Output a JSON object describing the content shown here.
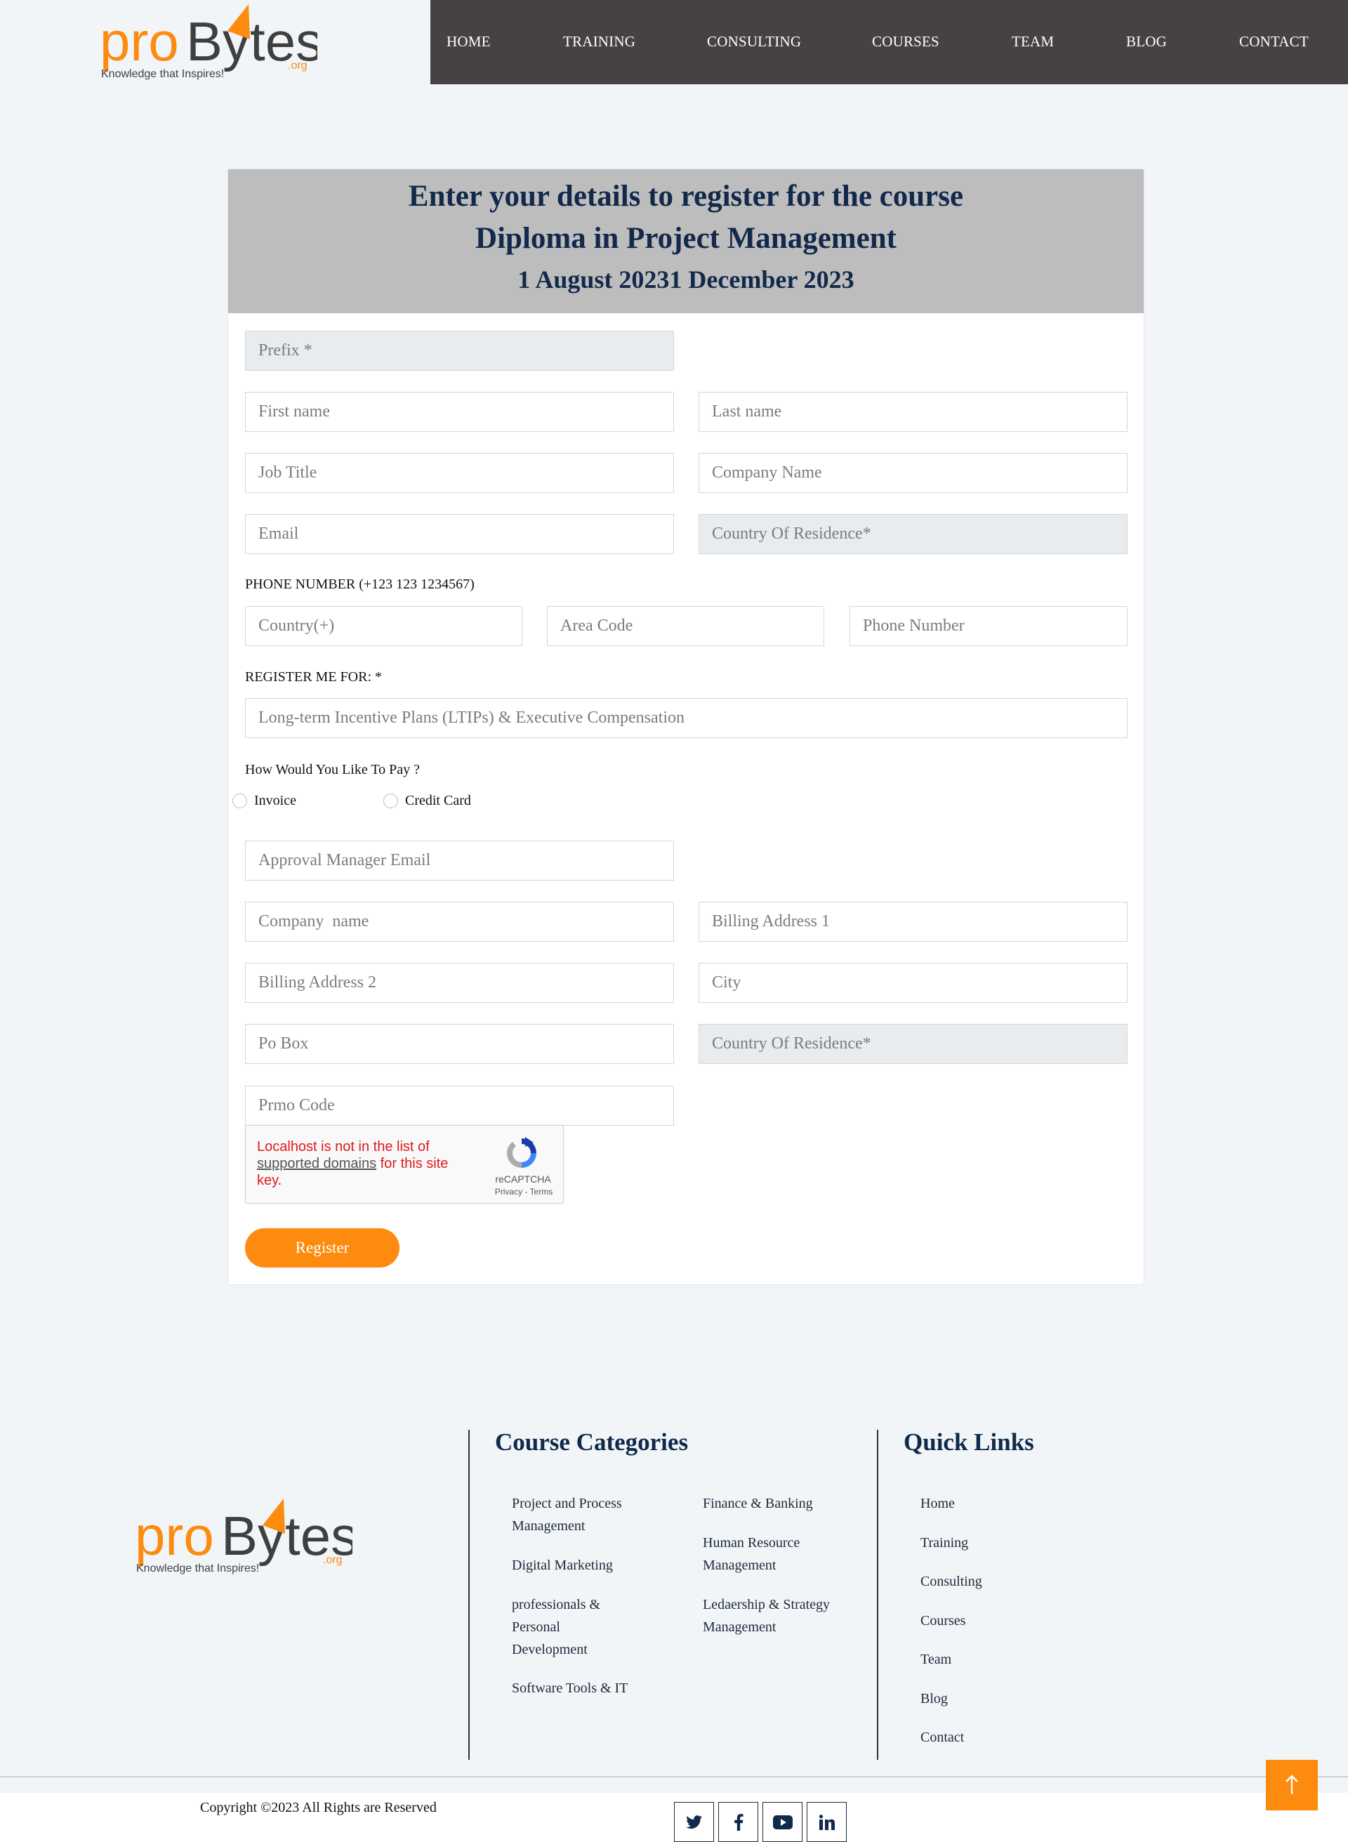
{
  "brand": {
    "logo_text_pro": "pro",
    "logo_text_bytes": "Bytes",
    "logo_domain": ".org",
    "tagline": "Knowledge that Inspires!",
    "orange": "#fc8b0f",
    "dark": "#3f3f3f"
  },
  "nav": {
    "items": [
      "HOME",
      "TRAINING",
      "CONSULTING",
      "COURSES",
      "TEAM",
      "BLOG",
      "CONTACT"
    ],
    "background": "#454241"
  },
  "form": {
    "heading_line1": "Enter your details to register for the course",
    "heading_line2": "Diploma in Project Management",
    "heading_line3": "1 August 20231 December 2023",
    "prefix_placeholder": "Prefix *",
    "first_name_placeholder": "First name",
    "last_name_placeholder": "Last name",
    "job_title_placeholder": "Job Title",
    "company_name_placeholder": "Company Name",
    "email_placeholder": "Email",
    "country_residence_placeholder": "Country Of Residence*",
    "phone_label": "PHONE NUMBER (+123 123 1234567)",
    "phone_country_placeholder": "Country(+)",
    "phone_area_placeholder": "Area Code",
    "phone_number_placeholder": "Phone Number",
    "register_for_label": "REGISTER ME FOR: *",
    "register_for_placeholder": "Long-term Incentive Plans (LTIPs) & Executive Compensation",
    "pay_label": "How Would You Like To Pay ?",
    "pay_invoice": "Invoice",
    "pay_credit_card": "Credit Card",
    "approval_email_placeholder": "Approval Manager Email",
    "billing_company_placeholder": "Company  name",
    "billing_address1_placeholder": "Billing Address 1",
    "billing_address2_placeholder": "Billing Address 2",
    "city_placeholder": "City",
    "po_box_placeholder": "Po Box",
    "billing_country_placeholder": "Country Of Residence*",
    "promo_placeholder": "Prmo Code",
    "captcha_error_pre": "Localhost is not in the list of",
    "captcha_error_link": "supported domains",
    "captcha_error_post": "for this site key.",
    "captcha_brand": "reCAPTCHA",
    "captcha_terms": "Privacy - Terms",
    "register_button": "Register"
  },
  "footer": {
    "course_categories_title": "Course Categories",
    "categories_col1": [
      "Project and Process Management",
      "Digital Marketing",
      "professionals & Personal Development",
      "Software Tools & IT"
    ],
    "categories_col2": [
      "Finance & Banking",
      "Human Resource Management",
      "Ledaership & Strategy Management"
    ],
    "quick_links_title": "Quick Links",
    "quick_links": [
      "Home",
      "Training",
      "Consulting",
      "Courses",
      "Team",
      "Blog",
      "Contact"
    ],
    "copyright": "Copyright ©2023 All Rights are Reserved",
    "social": [
      "twitter-icon",
      "facebook-icon",
      "youtube-icon",
      "linkedin-icon"
    ]
  }
}
